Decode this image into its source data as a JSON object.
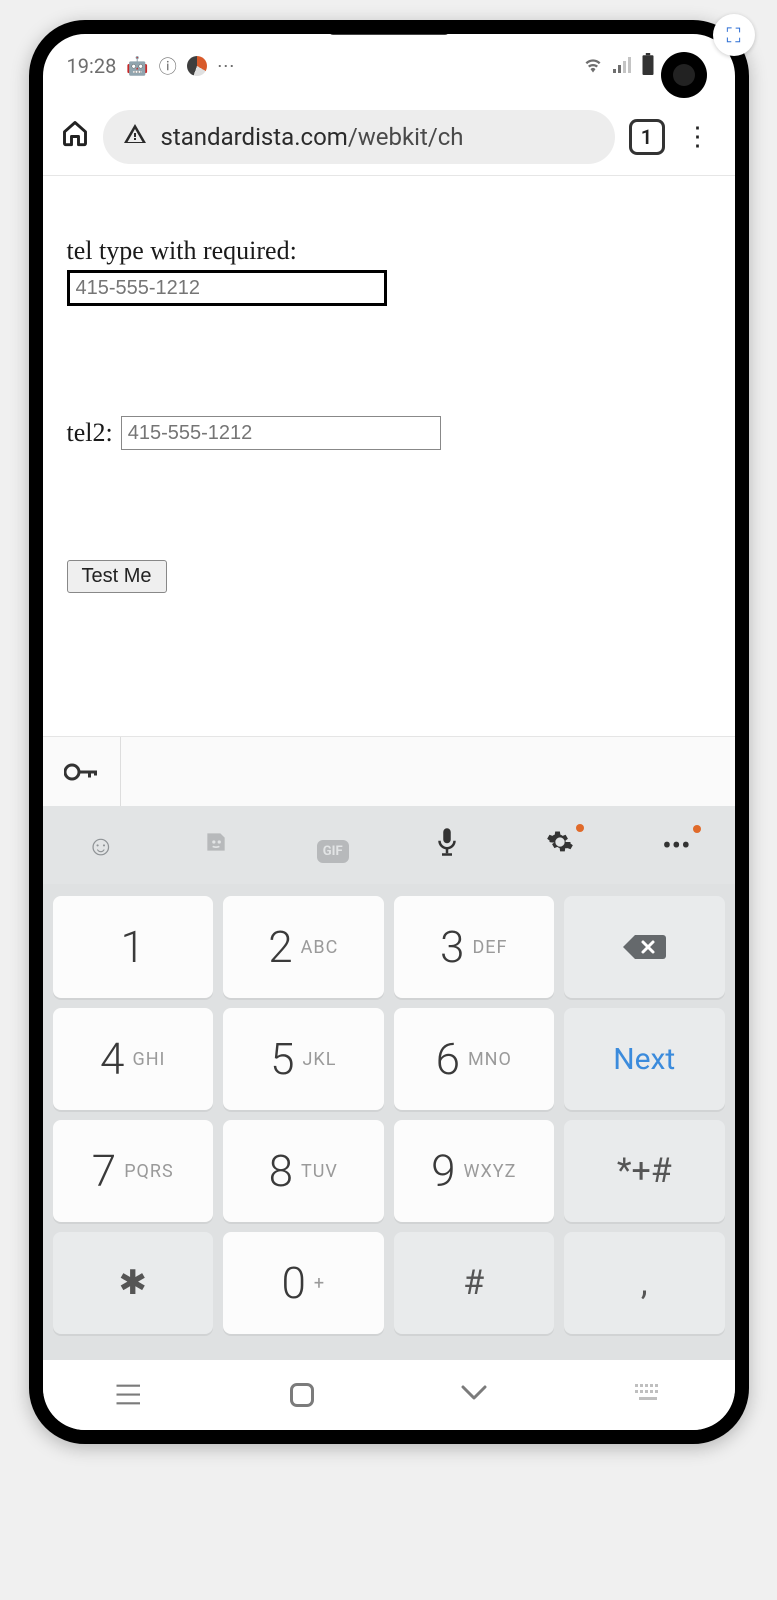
{
  "statusbar": {
    "time": "19:28",
    "icons": {
      "android": "android-icon",
      "info": "info-icon",
      "app": "app-swirl-icon",
      "more": "more-icon",
      "wifi": "wifi-icon",
      "signal": "signal-icon",
      "battery": "battery-icon"
    }
  },
  "browser": {
    "url_display": "standardista.com/webkit/ch",
    "site_name": "standardista.com",
    "path_tail": "/webkit/ch",
    "tab_count": "1"
  },
  "page": {
    "label1": "tel type with required:",
    "input1_placeholder": "415-555-1212",
    "label2": "tel2:",
    "input2_placeholder": "415-555-1212",
    "button": "Test Me"
  },
  "keyboard": {
    "next_label": "Next",
    "keys": [
      {
        "num": "1",
        "sub": ""
      },
      {
        "num": "2",
        "sub": "ABC"
      },
      {
        "num": "3",
        "sub": "DEF"
      },
      {
        "num": "4",
        "sub": "GHI"
      },
      {
        "num": "5",
        "sub": "JKL"
      },
      {
        "num": "6",
        "sub": "MNO"
      },
      {
        "num": "7",
        "sub": "PQRS"
      },
      {
        "num": "8",
        "sub": "TUV"
      },
      {
        "num": "9",
        "sub": "WXYZ"
      },
      {
        "num": "0",
        "sub": "+"
      }
    ],
    "sym_key": "*+#",
    "star_key": "✱",
    "pound_key": "#",
    "comma_key": ","
  }
}
